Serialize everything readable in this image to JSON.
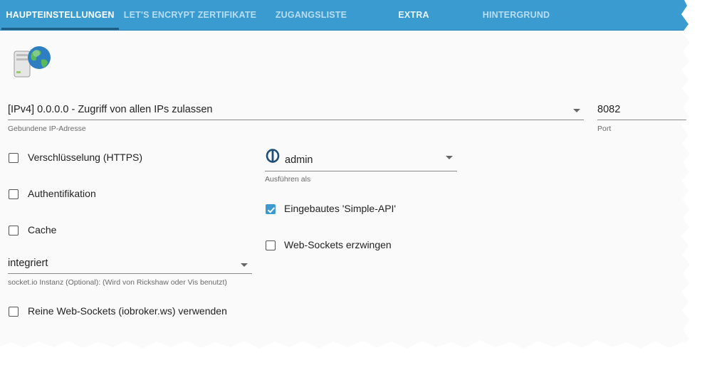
{
  "tabs": [
    {
      "label": "HAUPTEINSTELLUNGEN",
      "active": true
    },
    {
      "label": "LET'S ENCRYPT ZERTIFIKATE",
      "active": false
    },
    {
      "label": "ZUGANGSLISTE",
      "active": false
    },
    {
      "label": "EXTRA",
      "active": false
    },
    {
      "label": "HINTERGRUND",
      "active": false
    }
  ],
  "ip_select": {
    "value": "[IPv4] 0.0.0.0 - Zugriff von allen IPs zulassen",
    "helper": "Gebundene IP-Adresse"
  },
  "port": {
    "value": "8082",
    "helper": "Port"
  },
  "checkboxes_left": [
    {
      "label": "Verschlüsselung (HTTPS)",
      "checked": false
    },
    {
      "label": "Authentifikation",
      "checked": false
    },
    {
      "label": "Cache",
      "checked": false
    }
  ],
  "run_as": {
    "value": "admin",
    "helper": "Ausführen als",
    "icon": "user-icon"
  },
  "checkboxes_right": [
    {
      "label": "Eingebautes 'Simple-API'",
      "checked": true
    },
    {
      "label": "Web-Sockets erzwingen",
      "checked": false
    }
  ],
  "socketio_select": {
    "value": "integriert",
    "helper": "socket.io Instanz (Optional): (Wird von Rickshaw oder Vis benutzt)"
  },
  "reine_ws": {
    "label": "Reine Web-Sockets (iobroker.ws) verwenden",
    "checked": false
  },
  "colors": {
    "tabbar": "#3a9bd0",
    "active_tab_text": "#ffffff",
    "inactive_tab_text": "#b8ddf1",
    "checkbox_checked": "#3a9bd0"
  }
}
